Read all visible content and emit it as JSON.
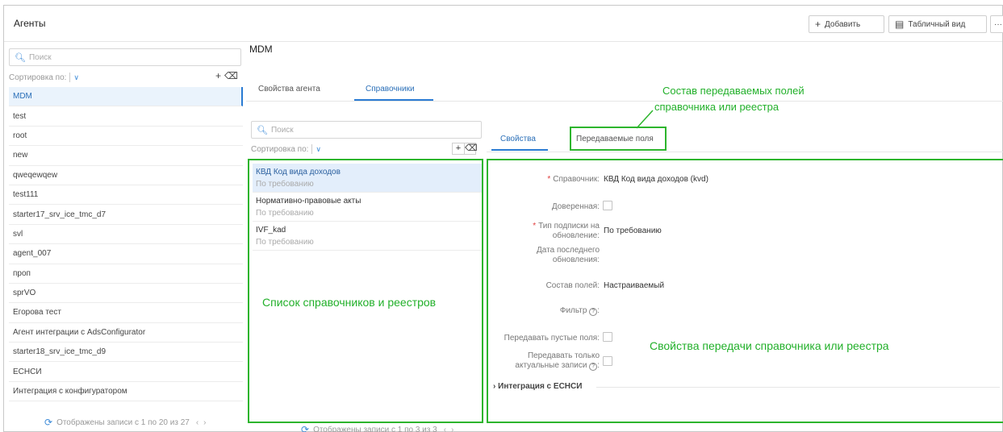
{
  "header": {
    "title": "Агенты",
    "add_label": "Добавить",
    "table_view_label": "Табличный вид",
    "more_label": "···"
  },
  "agents": {
    "search_placeholder": "Поиск",
    "sort_label": "Сортировка по:",
    "add_symbol": "+",
    "delete_symbol": "🗑",
    "items": [
      "MDM",
      "test",
      "root",
      "new",
      "qweqewqew",
      "test111",
      "starter17_srv_ice_tmc_d7",
      "svl",
      "agent_007",
      "проп",
      "sprVO",
      "Егорова тест",
      "Агент интеграции с AdsConfigurator",
      "starter18_srv_ice_tmc_d9",
      "ЕСНСИ",
      "Интеграция с конфигуратором"
    ],
    "pager_text": "Отображены записи с 1 по 20 из 27"
  },
  "entity": {
    "title": "MDM",
    "tabs": [
      "Свойства агента",
      "Справочники"
    ]
  },
  "dictionaries": {
    "search_placeholder": "Поиск",
    "sort_label": "Сортировка по:",
    "items": [
      {
        "name": "КВД Код вида доходов",
        "mode": "По требованию"
      },
      {
        "name": "Нормативно-правовые акты",
        "mode": "По требованию"
      },
      {
        "name": "IVF_kad",
        "mode": "По требованию"
      }
    ],
    "pager_text": "Отображены записи с 1 по 3 из 3"
  },
  "props": {
    "tabs": [
      "Свойства",
      "Передаваемые поля"
    ],
    "dictionary_label": "Справочник:",
    "dictionary_value": "КВД Код вида доходов (kvd)",
    "trusted_label": "Доверенная:",
    "subscription_label_1": "Тип подписки на",
    "subscription_label_2": "обновление:",
    "subscription_value": "По требованию",
    "last_update_label_1": "Дата последнего",
    "last_update_label_2": "обновления:",
    "fields_label": "Состав полей:",
    "fields_value": "Настраиваемый",
    "filter_label": "Фильтр",
    "empty_fields_label": "Передавать пустые поля:",
    "actual_only_label_1": "Передавать только",
    "actual_only_label_2": "актуальные записи",
    "integration_label": "Интеграция с ЕСНСИ"
  },
  "annotations": {
    "fields_callout_1": "Состав передаваемых полей",
    "fields_callout_2": "справочника или реестра",
    "list_callout": "Список справочников и реестров",
    "props_callout": "Свойства передачи справочника или реестра"
  }
}
